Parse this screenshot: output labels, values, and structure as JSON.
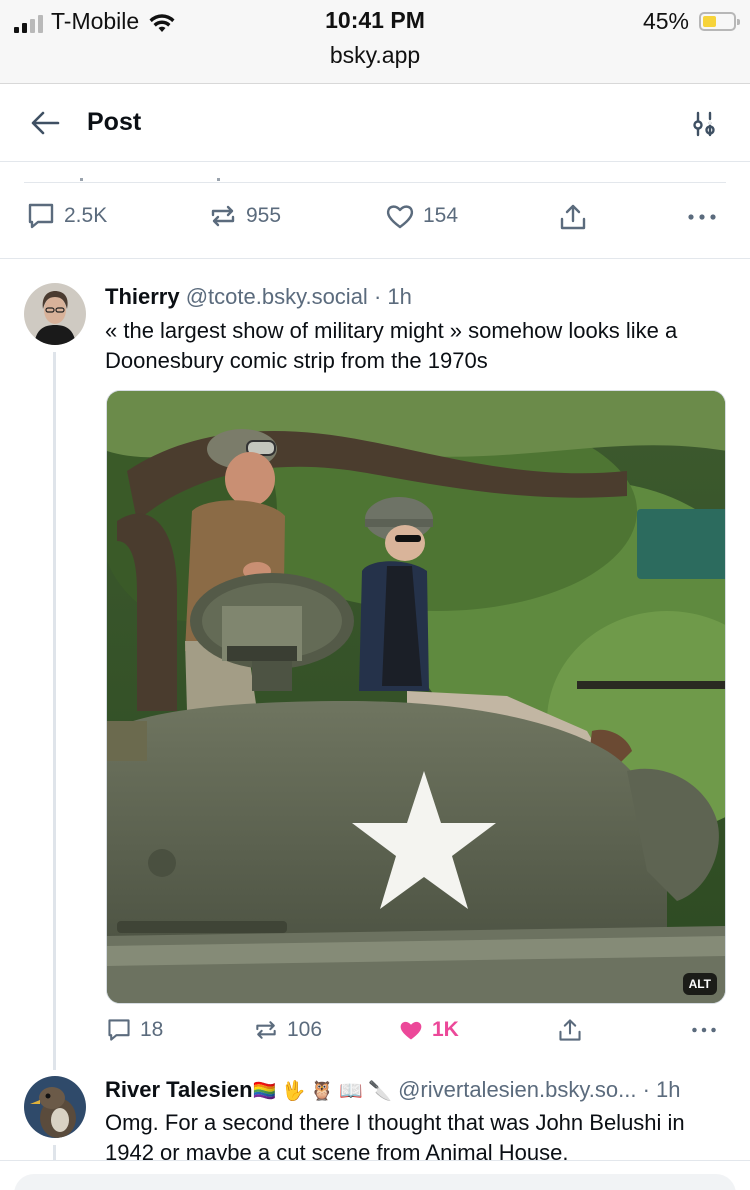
{
  "status_bar": {
    "carrier": "T-Mobile",
    "time": "10:41 PM",
    "url": "bsky.app",
    "battery": "45%",
    "battery_level": 0.45
  },
  "header": {
    "title": "Post",
    "back_icon": "arrow-left-icon",
    "settings_icon": "sliders-icon"
  },
  "root_post_actions": {
    "replies": "2.5K",
    "reposts": "955",
    "likes": "154"
  },
  "reply_post": {
    "author_name": "Thierry",
    "handle": "@tcote.bsky.social",
    "time": "· 1h",
    "text": "« the largest show of military might » somehow looks like a Doonesbury comic strip from the 1970s",
    "image_alt_badge": "ALT",
    "image_description": "Two people in helmets riding on top of a green tank with a white star",
    "actions": {
      "replies": "18",
      "reposts": "106",
      "likes": "1K",
      "liked": true
    }
  },
  "next_post": {
    "author_name": "River Talesien",
    "name_emoji": "🏳️‍🌈 🖖 🦉 📖 🔪",
    "handle": "@rivertalesien.bsky.so...",
    "time": "· 1h",
    "text": "Omg. For a second there I thought that was John Belushi in 1942 or maybe a cut scene from Animal House."
  },
  "colors": {
    "like_pink": "#ec4899",
    "muted": "#5b6b7d",
    "divider": "#e3e7ec"
  }
}
